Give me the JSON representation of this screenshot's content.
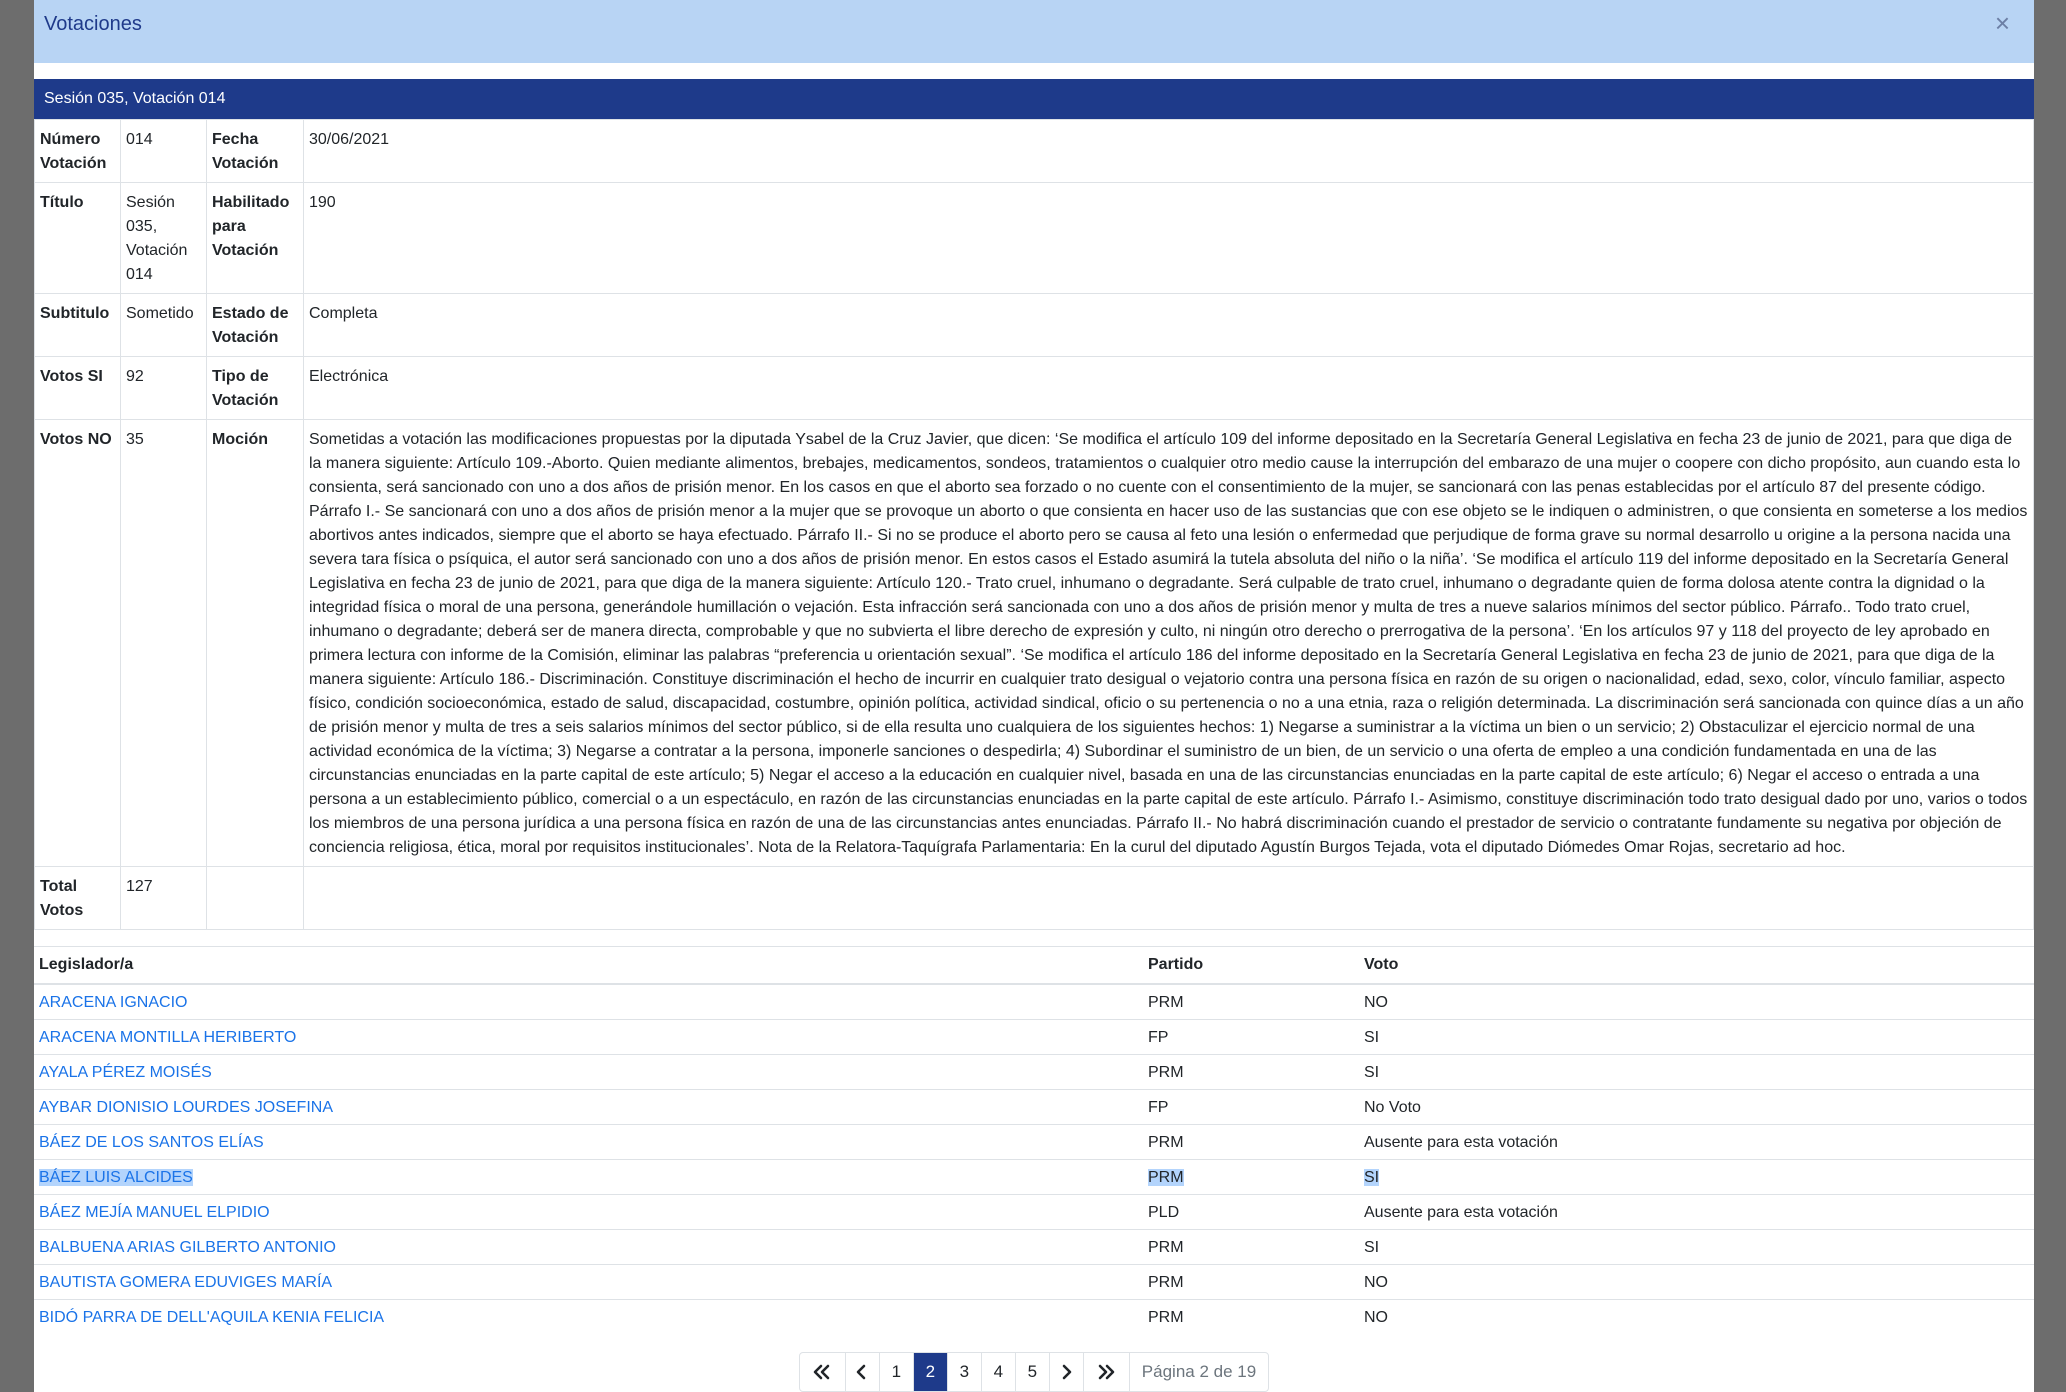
{
  "modal": {
    "title": "Votaciones",
    "close_symbol": "×"
  },
  "session_bar": "Sesión 035, Votación 014",
  "details": {
    "numero_label": "Número Votación",
    "numero_value": "014",
    "fecha_label": "Fecha Votación",
    "fecha_value": "30/06/2021",
    "titulo_label": "Título",
    "titulo_value": "Sesión 035, Votación 014",
    "habilitado_label": "Habilitado para Votación",
    "habilitado_value": "190",
    "subtitulo_label": "Subtitulo",
    "subtitulo_value": "Sometido",
    "estado_label": "Estado de Votación",
    "estado_value": "Completa",
    "votos_si_label": "Votos SI",
    "votos_si_value": "92",
    "tipo_label": "Tipo de Votación",
    "tipo_value": "Electrónica",
    "votos_no_label": "Votos NO",
    "votos_no_value": "35",
    "mocion_label": "Moción",
    "mocion_value": "Sometidas a votación las modificaciones propuestas por la diputada Ysabel de la Cruz Javier, que dicen: ‘Se modifica el artículo 109 del informe depositado en la Secretaría General Legislativa en fecha 23 de junio de 2021, para que diga de la manera siguiente: Artículo 109.-Aborto. Quien mediante alimentos, brebajes, medicamentos, sondeos, tratamientos o cualquier otro medio cause la interrupción del embarazo de una mujer o coopere con dicho propósito, aun cuando esta lo consienta, será sancionado con uno a dos años de prisión menor. En los casos en que el aborto sea forzado o no cuente con el consentimiento de la mujer, se sancionará con las penas establecidas por el artículo 87 del presente código. Párrafo I.- Se sancionará con uno a dos años de prisión menor a la mujer que se provoque un aborto o que consienta en hacer uso de las sustancias que con ese objeto se le indiquen o administren, o que consienta en someterse a los medios abortivos antes indicados, siempre que el aborto se haya efectuado. Párrafo II.- Si no se produce el aborto pero se causa al feto una lesión o enfermedad que perjudique de forma grave su normal desarrollo u origine a la persona nacida una severa tara física o psíquica, el autor será sancionado con uno a dos años de prisión menor. En estos casos el Estado asumirá la tutela absoluta del niño o la niña’. ‘Se modifica el artículo 119 del informe depositado en la Secretaría General Legislativa en fecha 23 de junio de 2021, para que diga de la manera siguiente: Artículo 120.- Trato cruel, inhumano o degradante. Será culpable de trato cruel, inhumano o degradante quien de forma dolosa atente contra la dignidad o la integridad física o moral de una persona, generándole humillación o vejación. Esta infracción será sancionada con uno a dos años de prisión menor y multa de tres a nueve salarios mínimos del sector público. Párrafo.. Todo trato cruel, inhumano o degradante; deberá ser de manera directa, comprobable y que no subvierta el libre derecho de expresión y culto, ni ningún otro derecho o prerrogativa de la persona’. ‘En los artículos 97 y 118 del proyecto de ley aprobado en primera lectura con informe de la Comisión, eliminar las palabras “preferencia u orientación sexual”. ‘Se modifica el artículo 186 del informe depositado en la Secretaría General Legislativa en fecha 23 de junio de 2021, para que diga de la manera siguiente: Artículo 186.- Discriminación. Constituye discriminación el hecho de incurrir en cualquier trato desigual o vejatorio contra una persona física en razón de su origen o nacionalidad, edad, sexo, color, vínculo familiar, aspecto físico, condición socioeconómica, estado de salud, discapacidad, costumbre, opinión política, actividad sindical, oficio o su pertenencia o no a una etnia, raza o religión determinada. La discriminación será sancionada con quince días a un año de prisión menor y multa de tres a seis salarios mínimos del sector público, si de ella resulta uno cualquiera de los siguientes hechos: 1) Negarse a suministrar a la víctima un bien o un servicio; 2) Obstaculizar el ejercicio normal de una actividad económica de la víctima; 3) Negarse a contratar a la persona, imponerle sanciones o despedirla; 4) Subordinar el suministro de un bien, de un servicio o una oferta de empleo a una condición fundamentada en una de las circunstancias enunciadas en la parte capital de este artículo; 5) Negar el acceso a la educación en cualquier nivel, basada en una de las circunstancias enunciadas en la parte capital de este artículo; 6) Negar el acceso o entrada a una persona a un establecimiento público, comercial o a un espectáculo, en razón de las circunstancias enunciadas en la parte capital de este artículo. Párrafo I.- Asimismo, constituye discriminación todo trato desigual dado por uno, varios o todos los miembros de una persona jurídica a una persona física en razón de una de las circunstancias antes enunciadas. Párrafo II.- No habrá discriminación cuando el prestador de servicio o contratante fundamente su negativa por objeción de conciencia religiosa, ética, moral por requisitos institucionales’. Nota de la Relatora-Taquígrafa Parlamentaria: En la curul del diputado Agustín Burgos Tejada, vota el diputado Diómedes Omar Rojas, secretario ad hoc.",
    "total_label": "Total Votos",
    "total_value": "127"
  },
  "votes": {
    "headers": [
      "Legislador/a",
      "Partido",
      "Voto"
    ],
    "rows": [
      {
        "name": "ARACENA IGNACIO",
        "party": "PRM",
        "vote": "NO"
      },
      {
        "name": "ARACENA MONTILLA HERIBERTO",
        "party": "FP",
        "vote": "SI"
      },
      {
        "name": "AYALA PÉREZ MOISÉS",
        "party": "PRM",
        "vote": "SI"
      },
      {
        "name": "AYBAR DIONISIO LOURDES JOSEFINA",
        "party": "FP",
        "vote": "No Voto"
      },
      {
        "name": "BÁEZ DE LOS SANTOS ELÍAS",
        "party": "PRM",
        "vote": "Ausente para esta votación"
      },
      {
        "name": "BÁEZ LUIS ALCIDES",
        "party": "PRM",
        "vote": "SI"
      },
      {
        "name": "BÁEZ MEJÍA MANUEL ELPIDIO",
        "party": "PLD",
        "vote": "Ausente para esta votación"
      },
      {
        "name": "BALBUENA ARIAS GILBERTO ANTONIO",
        "party": "PRM",
        "vote": "SI"
      },
      {
        "name": "BAUTISTA GOMERA EDUVIGES MARÍA",
        "party": "PRM",
        "vote": "NO"
      },
      {
        "name": "BIDÓ PARRA DE DELL'AQUILA KENIA FELICIA",
        "party": "PRM",
        "vote": "NO"
      }
    ],
    "selected_row": 5
  },
  "pagination": {
    "pages": [
      "1",
      "2",
      "3",
      "4",
      "5"
    ],
    "current": "2",
    "info": "Página 2 de 19",
    "icons": [
      "double-chevron-left-icon",
      "chevron-left-icon",
      "chevron-right-icon",
      "double-chevron-right-icon"
    ]
  },
  "colors": {
    "header_bg": "#b8d4f4",
    "session_bar": "#1e3a8a",
    "link": "#1a73e8",
    "active_page": "#1e3a8a",
    "selection": "#b3d4fc"
  }
}
